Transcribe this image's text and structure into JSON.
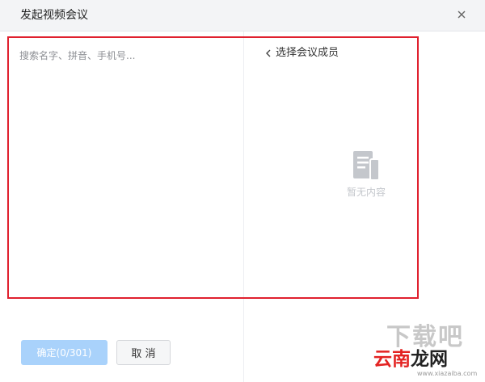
{
  "window": {
    "title": "发起视频会议",
    "close_icon": "close-icon"
  },
  "left_panel": {
    "search_placeholder": "搜索名字、拼音、手机号..."
  },
  "right_panel": {
    "back_icon": "chevron-left-icon",
    "title": "选择会议成员",
    "empty_icon": "document-icon",
    "empty_text": "暂无内容"
  },
  "footer": {
    "confirm_label": "确定(0/301)",
    "cancel_label": "取 消"
  },
  "watermark": {
    "top_text": "下载吧",
    "main_text_red": "云南",
    "main_text_dark": "龙网",
    "url_text": "www.xiazaiba.com"
  },
  "colors": {
    "highlight_frame": "#e0202e",
    "confirm_bg_disabled": "#a9d2fb",
    "titlebar_bg": "#f3f4f6"
  }
}
